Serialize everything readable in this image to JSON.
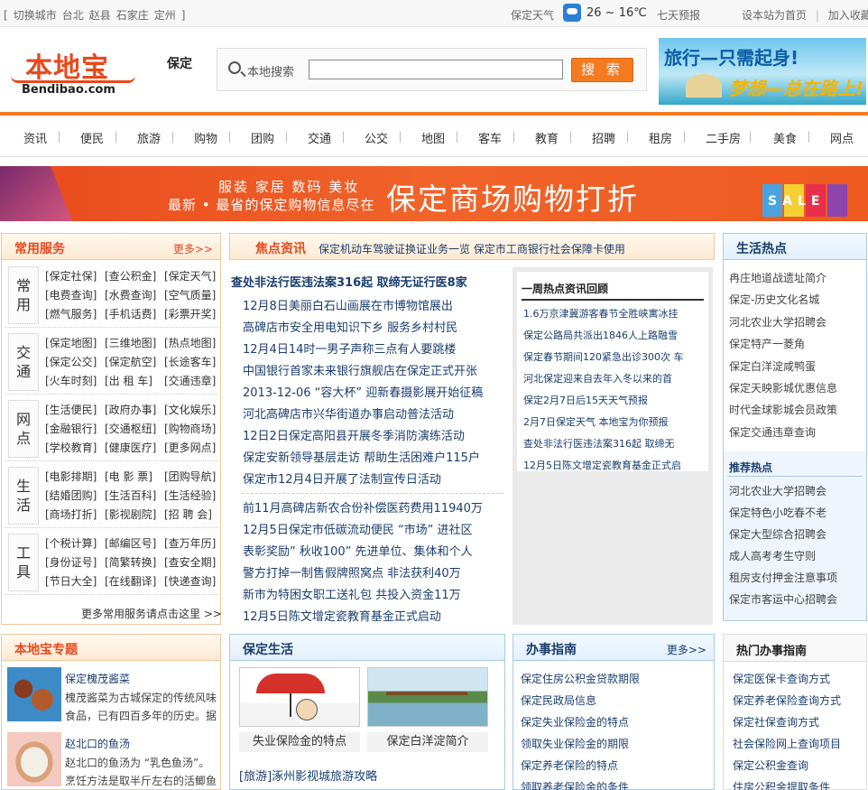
{
  "topbar": {
    "cities": [
      "[",
      "切换城市",
      "台北",
      "赵县",
      "石家庄",
      "定州",
      "]"
    ],
    "weather_label": "保定天气",
    "temperature": "26 ~ 16℃",
    "forecast": "七天预报",
    "set_home": "设本站为首页",
    "divider": "|",
    "bookmark": "加入收藏"
  },
  "header": {
    "logo_main": "本地宝",
    "logo_url": "Bendibao.com",
    "city": "保定",
    "search_label": "本地搜索",
    "search_value": "",
    "search_button": "搜 索",
    "ad_line1": "旅行—只需起身!",
    "ad_line2": "梦想—总在路上!"
  },
  "nav": [
    "资讯",
    "便民",
    "旅游",
    "购物",
    "团购",
    "交通",
    "公交",
    "地图",
    "客车",
    "教育",
    "招聘",
    "租房",
    "二手房",
    "美食",
    "网点"
  ],
  "nav_sep": "|",
  "banner": {
    "categories": "服装  家居  数码  美妆",
    "subtitle": "最新 • 最省的保定购物信息尽在",
    "title": "保定商场购物打折",
    "sale": "SALE"
  },
  "services": {
    "title": "常用服务",
    "more": "更多>>",
    "groups": [
      {
        "label": [
          "常",
          "用"
        ],
        "items": [
          "[保定社保]",
          "[查公积金]",
          "[保定天气]",
          "[电费查询]",
          "[水费查询]",
          "[空气质量]",
          "[燃气服务]",
          "[手机话费]",
          "[彩票开奖]"
        ]
      },
      {
        "label": [
          "交",
          "通"
        ],
        "items": [
          "[保定地图]",
          "[三维地图]",
          "[热点地图]",
          "[保定公交]",
          "[保定航空]",
          "[长途客车]",
          "[火车时刻]",
          "[出 租 车]",
          "[交通违章]"
        ]
      },
      {
        "label": [
          "网",
          "点"
        ],
        "items": [
          "[生活便民]",
          "[政府办事]",
          "[文化娱乐]",
          "[金融银行]",
          "[交通枢纽]",
          "[购物商场]",
          "[学校教育]",
          "[健康医疗]",
          "[更多网点]"
        ]
      },
      {
        "label": [
          "生",
          "活"
        ],
        "items": [
          "[电影排期]",
          "[电 影 票]",
          "[团购导航]",
          "[结婚团购]",
          "[生活百科]",
          "[生活经验]",
          "[商场打折]",
          "[影视剧院]",
          "[招 聘 会]"
        ]
      },
      {
        "label": [
          "工",
          "具"
        ],
        "items": [
          "[个税计算]",
          "[邮编区号]",
          "[查万年历]",
          "[身份证号]",
          "[简繁转换]",
          "[查安全期]",
          "[节日大全]",
          "[在线翻译]",
          "[快递查询]"
        ]
      }
    ],
    "more_link": "更多常用服务请点击这里 >>"
  },
  "focus": {
    "title": "焦点资讯",
    "ticker": "保定机动车驾驶证换证业务一览  保定市工商银行社会保障卡使用",
    "headline": "查处非法行医违法案316起  取缔无证行医8家",
    "items_a": [
      "12月8日美丽白石山画展在市博物馆展出",
      "高碑店市安全用电知识下乡 服务乡村村民",
      "12月4日14时一男子声称三点有人要跳楼",
      "中国银行首家未来银行旗舰店在保定正式开张",
      "2013-12-06 “容大杯” 迎新春摄影展开始征稿",
      "河北高碑店市兴华街道办事启动普法活动",
      "12日2日保定高阳县开展冬季消防演练活动",
      "保定安新领导基层走访 帮助生活困难户115户",
      "保定市12月4日开展了法制宣传日活动"
    ],
    "items_b": [
      "前11月高碑店新农合份补偿医药费用11940万",
      "12月5日保定市低碳流动便民 “市场” 进社区",
      "表彰奖励” 秋收100” 先进单位、集体和个人",
      "警方打掉一制售假牌照窝点 非法获利40万",
      "新市为特困女职工送礼包 共投入资金11万",
      "12月5日陈文增定瓷教育基金正式启动"
    ]
  },
  "week": {
    "title": "一周热点资讯回顾",
    "items": [
      "1.6万京津冀游客春节全胜峡寓冰挂",
      "保定公路局共派出1846人上路融雪",
      "保定春节期间120紧急出诊300次 车",
      "河北保定迎来自去年入冬以来的首",
      "保定2月7日后15天天气预报",
      "2月7日保定天气 本地宝为你预报",
      "查处非法行医违法案316起 取缔无",
      "12月5日陈文增定瓷教育基金正式启"
    ]
  },
  "life": {
    "title": "生活热点",
    "items": [
      "冉庄地道战遗址简介",
      "保定-历史文化名城",
      "河北农业大学招聘会",
      "保定特产一菱角",
      "保定白洋淀咸鸭蛋",
      "保定天映影城优惠信息",
      "时代金球影城会员政策",
      "保定交通违章查询"
    ],
    "sub_title": "推荐热点",
    "sub_items": [
      "河北农业大学招聘会",
      "保定特色小吃春不老",
      "保定大型综合招聘会",
      "成人高考考生守则",
      "租房支付押金注意事项",
      "保定市客运中心招聘会"
    ]
  },
  "topic": {
    "title": "本地宝专题",
    "items": [
      {
        "title": "保定槐茂酱菜",
        "desc": "槐茂酱菜为古城保定的传统风味食品，已有四百多年的历史。据"
      },
      {
        "title": "赵北口的鱼汤",
        "desc": "赵北口的鱼汤为 “乳色鱼汤”。烹饪方法是取半斤左右的活鲫鱼"
      }
    ]
  },
  "livesec": {
    "title": "保定生活",
    "pics": [
      "失业保险金的特点",
      "保定白洋淀简介"
    ],
    "link": "[旅游]涿州影视城旅游攻略"
  },
  "guide": {
    "title": "办事指南",
    "more": "更多>>",
    "items": [
      "保定住房公积金贷款期限",
      "保定民政局信息",
      "保定失业保险金的特点",
      "领取失业保险金的期限",
      "保定养老保险的特点",
      "领取养老保险金的条件"
    ]
  },
  "hotguide": {
    "title": "热门办事指南",
    "items": [
      "保定医保卡查询方式",
      "保定养老保险查询方式",
      "保定社保查询方式",
      "社会保险网上查询项目",
      "保定公积金查询",
      "住房公积金提取条件"
    ]
  },
  "colors": {
    "accent": "#f47b20",
    "brand": "#e8491d",
    "link": "#1a3e6e"
  }
}
